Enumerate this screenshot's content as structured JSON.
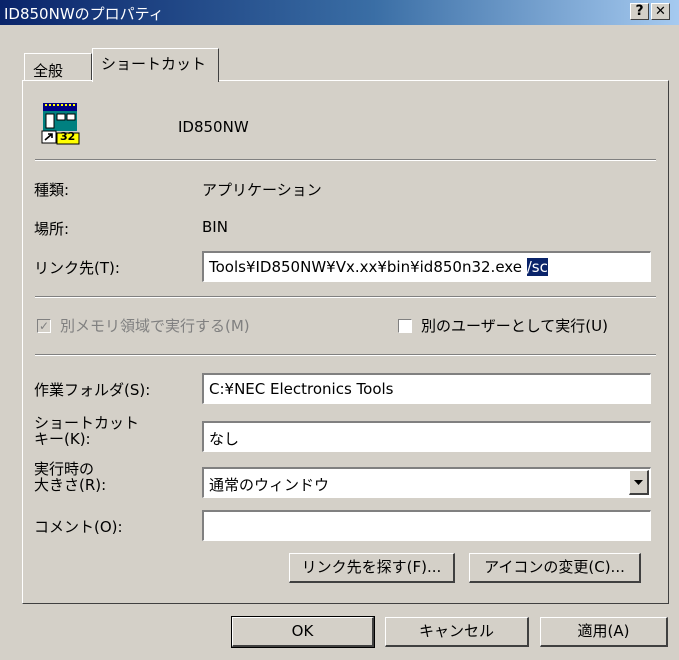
{
  "window": {
    "title": "ID850NWのプロパティ",
    "help_btn": "?",
    "close_btn": "✕"
  },
  "tabs": [
    {
      "label": "全般"
    },
    {
      "label": "ショートカット"
    }
  ],
  "app_name": "ID850NW",
  "app_icon": {
    "name": "application-icon",
    "badge": "32"
  },
  "fields": {
    "type_label": "種類:",
    "type_value": "アプリケーション",
    "location_label": "場所:",
    "location_value": "BIN",
    "target_label": "リンク先(T):",
    "target_value": "Tools¥ID850NW¥Vx.xx¥bin¥id850n32.exe ",
    "target_selected": "/sc",
    "separate_memory_label": "別メモリ領域で実行する(M)",
    "separate_memory_checked": true,
    "run_as_user_label": "別のユーザーとして実行(U)",
    "run_as_user_checked": false,
    "workdir_label": "作業フォルダ(S):",
    "workdir_value": "C:¥NEC Electronics Tools",
    "shortcut_label_1": "ショートカット",
    "shortcut_label_2": "キー(K):",
    "shortcut_value": "なし",
    "run_label_1": "実行時の",
    "run_label_2": "大きさ(R):",
    "run_value": "通常のウィンドウ",
    "comment_label": "コメント(O):",
    "comment_value": ""
  },
  "buttons": {
    "find_target": "リンク先を探す(F)...",
    "change_icon": "アイコンの変更(C)...",
    "ok": "OK",
    "cancel": "キャンセル",
    "apply": "適用(A)"
  }
}
